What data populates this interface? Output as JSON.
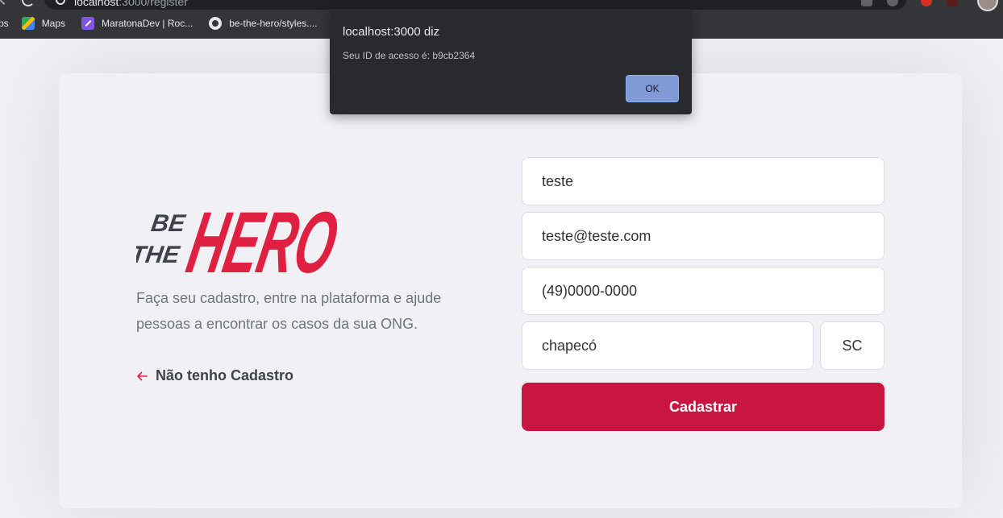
{
  "browser": {
    "url_host": "localhost",
    "url_path": ":3000/register",
    "bookmarks": [
      {
        "label": "ps",
        "icon": "apps-icon"
      },
      {
        "label": "Maps",
        "icon": "maps-icon"
      },
      {
        "label": "MaratonaDev | Roc...",
        "icon": "rocketseat-icon"
      },
      {
        "label": "be-the-hero/styles....",
        "icon": "github-icon"
      }
    ]
  },
  "alert": {
    "title": "localhost:3000 diz",
    "message": "Seu ID de acesso é: b9cb2364",
    "ok_label": "OK"
  },
  "hero": {
    "logo_small_1": "BE",
    "logo_small_2": "THE",
    "logo_big": "HERO",
    "description": "Faça seu cadastro, entre na plataforma e ajude pessoas a encontrar os casos da sua ONG.",
    "back_link": "Não tenho Cadastro"
  },
  "form": {
    "name": "teste",
    "email": "teste@teste.com",
    "whatsapp": "(49)0000-0000",
    "city": "chapecó",
    "uf": "SC",
    "submit_label": "Cadastrar"
  },
  "colors": {
    "brand": "#e02041",
    "button": "#c81640",
    "dialog_bg": "#292a2d",
    "dialog_button": "#7f9ad6"
  }
}
